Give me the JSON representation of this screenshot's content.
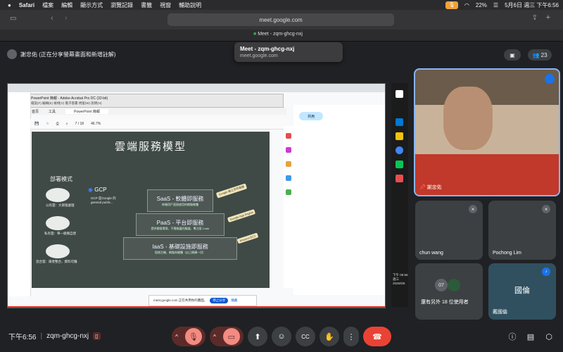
{
  "menubar": {
    "app": "Safari",
    "items": [
      "檔案",
      "編輯",
      "顯示方式",
      "瀏覽記錄",
      "書籤",
      "視窗",
      "輔助說明"
    ],
    "battery": "22%",
    "clock": "5月6日 週三 下午6:56"
  },
  "safari": {
    "url": "meet.google.com",
    "tab_title": "Meet - zqm-ghcg-nxj"
  },
  "tooltip": {
    "title": "Meet - zqm-ghcg-nxj",
    "url": "meet.google.com"
  },
  "meet": {
    "presenter": "謝忠佑 (正在分享螢幕畫面和新增註解)",
    "participant_count": "23",
    "meeting_code": "zqm-ghcg-nxj",
    "time": "下午6:56"
  },
  "shared": {
    "acrobat_title": "PowerPoint 簡報 - Adobe Acrobat Pro DC (32-bit)",
    "acrobat_menu": "檔案(F)  編輯(E)  檢視(V)  電子簽署  視窗(W)  說明(H)",
    "tabs": [
      "首頁",
      "工具",
      "PowerPoint 簡報"
    ],
    "page": "7 / 18",
    "zoom": "46.7%",
    "share_btn": "共用",
    "notice": "meet.google.com 正在共用你的畫面。",
    "stop_share": "停止分享",
    "hide": "隱藏",
    "taskbar_time": "下午 06:56\n週三\n2026/5/6"
  },
  "slide": {
    "title": "雲端服務模型",
    "deploy_title": "部署模式",
    "gcp": "GCP",
    "gcp_sub": "GCP 是Google 的 general public...",
    "clouds": [
      "公有雲：大眾版處理",
      "私有雲：單一組織自建",
      "混合雲：兩者整合，資料可攜"
    ],
    "layers": [
      {
        "name": "SaaS - 軟體即服務",
        "sub": "終端用戶直接使用的網路軟體"
      },
      {
        "name": "PaaS - 平台即服務",
        "sub": "提供開發環境，不需維護伺服器，專注寫 Code"
      },
      {
        "name": "IaaS - 基礎設施即服務",
        "sub": "租借主機、網路與硬體（自己建構一切）"
      }
    ],
    "tags": [
      "Google 線上文件服務",
      "Google App Engine",
      "Amazon EC2"
    ]
  },
  "tiles": [
    {
      "name": "謝忠佑"
    },
    {
      "name": "chun wang"
    },
    {
      "name": "Pochong Lim"
    },
    {
      "name": "還有另外 18 位使用者",
      "count": "07"
    },
    {
      "name": "戴國倫",
      "initials": "國倫"
    }
  ]
}
